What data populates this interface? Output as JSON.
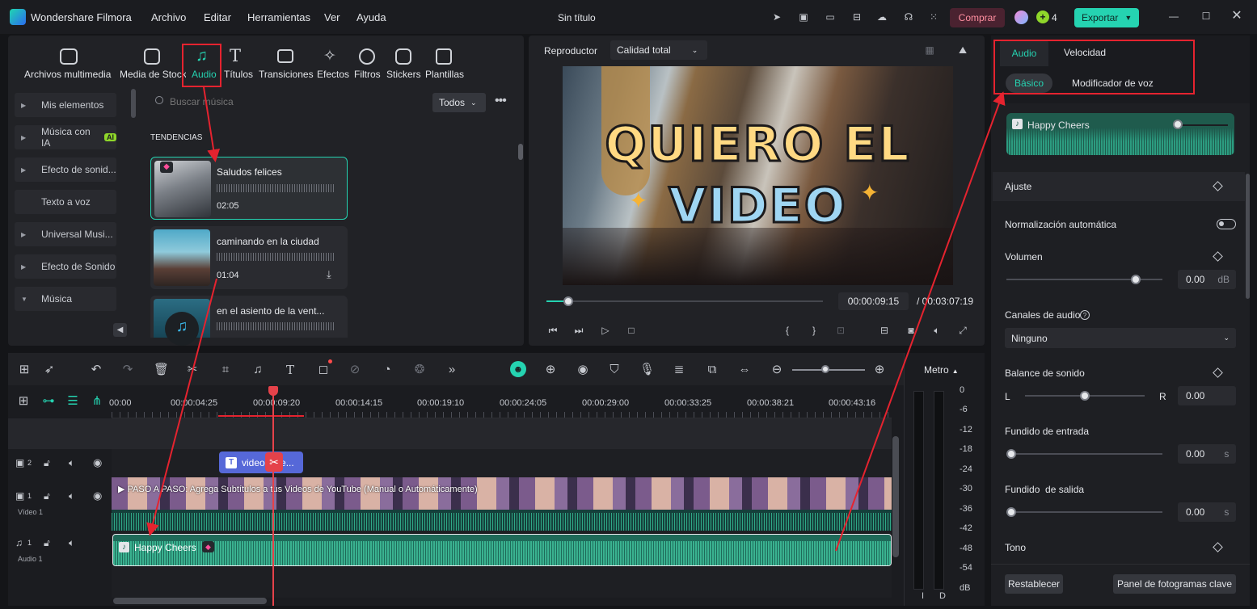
{
  "app": {
    "name": "Wondershare Filmora",
    "title": "Sin título",
    "menu": [
      "Archivo",
      "Editar",
      "Herramientas",
      "Ver",
      "Ayuda"
    ],
    "buy": "Comprar",
    "export": "Exportar",
    "credits": "4",
    "accent": "#25d3b1"
  },
  "media_tabs": [
    {
      "label": "Archivos multimedia",
      "icon": "media-icon"
    },
    {
      "label": "Media de Stock",
      "icon": "stock-icon"
    },
    {
      "label": "Audio",
      "icon": "music-note-icon",
      "active": true
    },
    {
      "label": "Títulos",
      "icon": "text-icon"
    },
    {
      "label": "Transiciones",
      "icon": "transition-icon"
    },
    {
      "label": "Efectos",
      "icon": "effects-icon"
    },
    {
      "label": "Filtros",
      "icon": "filter-icon"
    },
    {
      "label": "Stickers",
      "icon": "sticker-icon"
    },
    {
      "label": "Plantillas",
      "icon": "template-icon"
    }
  ],
  "sidebar": {
    "items": [
      "Mis elementos",
      "Música con IA",
      "Efecto de sonid...",
      "Texto a voz",
      "Universal Musi...",
      "Efecto de Sonido",
      "Música"
    ],
    "ai_badge": "AI"
  },
  "search": {
    "placeholder": "Buscar música",
    "filter": "Todos"
  },
  "section_title": "TENDENCIAS",
  "tracks": [
    {
      "title": "Saludos felices",
      "duration": "02:05"
    },
    {
      "title": "caminando en la ciudad",
      "duration": "01:04"
    },
    {
      "title": "en el asiento de la vent...",
      "duration": ""
    }
  ],
  "player": {
    "label": "Reproductor",
    "quality": "Calidad total",
    "caption_line1": "QUIERO EL",
    "caption_line2": "VIDEO",
    "current": "00:00:09:15",
    "total": "/ 00:03:07:19",
    "progress": 0.02
  },
  "right_panel": {
    "tabs": [
      "Audio",
      "Velocidad"
    ],
    "subtabs": [
      "Básico",
      "Modificador de voz"
    ],
    "clip_name": "Happy Cheers",
    "ajuste": "Ajuste",
    "normalizacion": "Normalización automática",
    "volumen": {
      "label": "Volumen",
      "value": "0.00",
      "unit": "dB",
      "level": 0.83
    },
    "canales": {
      "label": "Canales de audio",
      "value": "Ninguno"
    },
    "balance": {
      "label": "Balance de sonido",
      "left": "L",
      "right": "R",
      "value": "0.00",
      "level": 0.5
    },
    "fade_in": {
      "label": "Fundido de entrada",
      "value": "0.00",
      "unit": "s"
    },
    "fade_out": {
      "label": "Fundido  de salida",
      "value": "0.00",
      "unit": "s"
    },
    "tono": "Tono",
    "reset": "Restablecer",
    "keyframe": "Panel de fotogramas clave"
  },
  "timeline": {
    "ruler": [
      "00:00",
      "00:00:04:25",
      "00:00:09:20",
      "00:00:14:15",
      "00:00:19:10",
      "00:00:24:05",
      "00:00:29:00",
      "00:00:33:25",
      "00:00:38:21",
      "00:00:43:16"
    ],
    "meter_label": "Metro",
    "meter_scale": [
      "0",
      "-6",
      "-12",
      "-18",
      "-24",
      "-30",
      "-36",
      "-42",
      "-48",
      "-54",
      "dB"
    ],
    "meter_lr": [
      "I",
      "D"
    ],
    "title_clip": "video quie...",
    "video_clip": "PASO A PASO: Agrega Subtítulos a tus Videos de YouTube (Manual o Automáticamente)",
    "audio_clip": "Happy Cheers",
    "video_track": "Vídeo 1",
    "audio_track": "Audio 1",
    "track_nums": [
      "2",
      "1",
      "1"
    ]
  }
}
